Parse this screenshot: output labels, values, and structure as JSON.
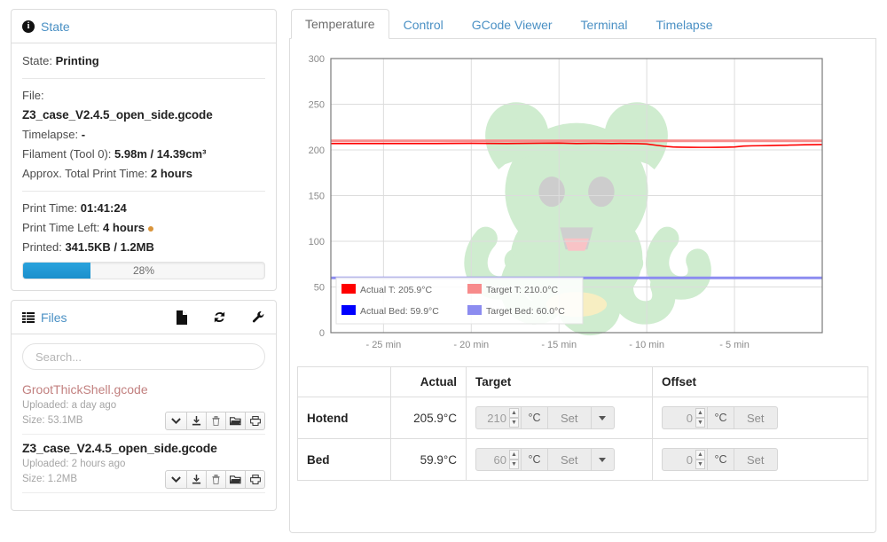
{
  "state_panel": {
    "title": "State",
    "icon": "info-icon",
    "state_label": "State:",
    "state_value": "Printing",
    "file_label": "File:",
    "file_value": "Z3_case_V2.4.5_open_side.gcode",
    "timelapse_label": "Timelapse:",
    "timelapse_value": "-",
    "filament_label": "Filament (Tool 0):",
    "filament_value": "5.98m / 14.39cm³",
    "approx_label": "Approx. Total Print Time:",
    "approx_value": "2 hours",
    "print_time_label": "Print Time:",
    "print_time_value": "01:41:24",
    "print_time_left_label": "Print Time Left:",
    "print_time_left_value": "4 hours",
    "printed_label": "Printed:",
    "printed_value": "341.5KB / 1.2MB",
    "progress_percent": "28%",
    "progress_value": 28
  },
  "files_panel": {
    "title": "Files",
    "icons": [
      "list-icon",
      "file-icon",
      "refresh-icon",
      "wrench-icon"
    ],
    "search_placeholder": "Search...",
    "search_value": "",
    "items": [
      {
        "name": "GrootThickShell.gcode",
        "uploaded": "Uploaded: a day ago",
        "size": "Size: 53.1MB",
        "selected": false,
        "actions": [
          "chevron-down-icon",
          "download-icon",
          "trash-icon",
          "folder-open-icon",
          "print-icon"
        ]
      },
      {
        "name": "Z3_case_V2.4.5_open_side.gcode",
        "uploaded": "Uploaded: 2 hours ago",
        "size": "Size: 1.2MB",
        "selected": true,
        "actions": [
          "chevron-down-icon",
          "download-icon",
          "trash-icon",
          "folder-open-icon",
          "print-icon"
        ]
      }
    ]
  },
  "tabs": [
    {
      "label": "Temperature",
      "active": true
    },
    {
      "label": "Control",
      "active": false
    },
    {
      "label": "GCode Viewer",
      "active": false
    },
    {
      "label": "Terminal",
      "active": false
    },
    {
      "label": "Timelapse",
      "active": false
    }
  ],
  "chart_data": {
    "type": "line",
    "title": "",
    "xlabel": "",
    "ylabel": "",
    "ylim": [
      0,
      300
    ],
    "yticks": [
      0,
      50,
      100,
      150,
      200,
      250,
      300
    ],
    "xlim": [
      -28,
      0
    ],
    "xticks": [
      -25,
      -20,
      -15,
      -10,
      -5
    ],
    "xticklabels": [
      "- 25 min",
      "- 20 min",
      "- 15 min",
      "- 10 min",
      "- 5 min"
    ],
    "grid": true,
    "legend_position": "inside-bottom-left",
    "legend": [
      {
        "name": "Actual T: 205.9°C",
        "color": "#ff0000"
      },
      {
        "name": "Target T: 210.0°C",
        "color": "#f78b8b"
      },
      {
        "name": "Actual Bed: 59.9°C",
        "color": "#0000ff"
      },
      {
        "name": "Target Bed: 60.0°C",
        "color": "#8c8cf0"
      }
    ],
    "series": [
      {
        "name": "Actual T",
        "color": "#ff0000",
        "x": [
          -28,
          -26,
          -24,
          -22,
          -20,
          -18,
          -16,
          -15,
          -14,
          -13,
          -12,
          -11.5,
          -11,
          -10.5,
          -10,
          -9.5,
          -9,
          -8.5,
          -8,
          -7.5,
          -7,
          -6.5,
          -6,
          -5.5,
          -5,
          -4.5,
          -4,
          -3.5,
          -3,
          -2.5,
          -2,
          -1.5,
          -1,
          -0.5,
          0
        ],
        "y": [
          207,
          207,
          207,
          207,
          207.2,
          207,
          207.3,
          207.5,
          207,
          207.2,
          207,
          207.1,
          207,
          206.9,
          206.5,
          205.2,
          204.0,
          203.2,
          203.0,
          202.9,
          202.8,
          202.8,
          202.9,
          203.0,
          203.2,
          204.2,
          204.5,
          204.6,
          204.8,
          205.0,
          205.2,
          205.4,
          205.6,
          205.8,
          205.9
        ]
      },
      {
        "name": "Target T",
        "color": "#f78b8b",
        "x": [
          -28,
          0
        ],
        "y": [
          210,
          210
        ]
      },
      {
        "name": "Actual Bed",
        "color": "#0000ff",
        "x": [
          -28,
          0
        ],
        "y": [
          59.9,
          59.9
        ]
      },
      {
        "name": "Target Bed",
        "color": "#8c8cf0",
        "x": [
          -28,
          0
        ],
        "y": [
          60,
          60
        ]
      }
    ]
  },
  "temp_table": {
    "headers": [
      "",
      "Actual",
      "Target",
      "Offset"
    ],
    "rows": [
      {
        "label": "Hotend",
        "actual": "205.9°C",
        "target_value": "210",
        "target_unit": "°C",
        "target_set": "Set",
        "offset_value": "0",
        "offset_unit": "°C",
        "offset_set": "Set"
      },
      {
        "label": "Bed",
        "actual": "59.9°C",
        "target_value": "60",
        "target_unit": "°C",
        "target_set": "Set",
        "offset_value": "0",
        "offset_unit": "°C",
        "offset_set": "Set"
      }
    ]
  },
  "colors": {
    "accent_blue": "#4a90c4",
    "progress_blue": "#1b8fcc",
    "actual_temp": "#ff0000",
    "target_temp": "#f78b8b",
    "actual_bed": "#0000ff",
    "target_bed": "#8c8cf0",
    "watermark_green": "#cfeccf"
  }
}
